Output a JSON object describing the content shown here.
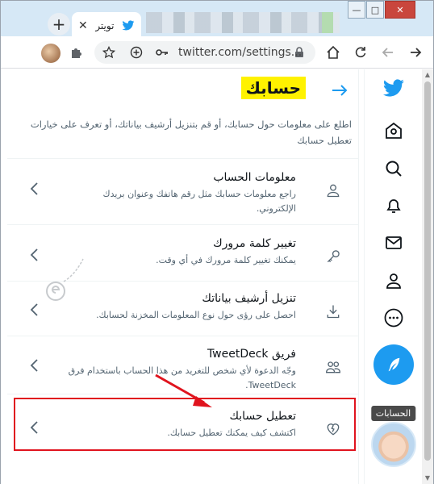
{
  "browser": {
    "tab": {
      "title": "تويتر"
    },
    "new_tab_label": "+",
    "address": "twitter.com/settings..."
  },
  "sidebar": {
    "tooltip": "الحسابات"
  },
  "header": {
    "title": "حسابك"
  },
  "intro": "اطلع على معلومات حول حسابك، أو قم بتنزيل أرشيف بياناتك، أو تعرف على خيارات تعطيل حسابك",
  "settings": [
    {
      "title": "معلومات الحساب",
      "desc": "راجع معلومات حسابك مثل رقم هاتفك وعنوان بريدك الإلكتروني."
    },
    {
      "title": "تغيير كلمة مرورك",
      "desc": "يمكنك تغيير كلمة مرورك في أي وقت."
    },
    {
      "title": "تنزيل أرشيف بياناتك",
      "desc": "احصل على رؤى حول نوع المعلومات المخزنة لحسابك."
    },
    {
      "title": "فريق TweetDeck",
      "desc": "وجّه الدعوة لأي شخص للتغريد من هذا الحساب باستخدام فرق TweetDeck."
    },
    {
      "title": "تعطيل حسابك",
      "desc": "اكتشف كيف يمكنك تعطيل حسابك."
    }
  ],
  "colors": {
    "twitter_blue": "#1d9bf0",
    "highlight": "#fff200",
    "annotation_red": "#e0141e"
  }
}
